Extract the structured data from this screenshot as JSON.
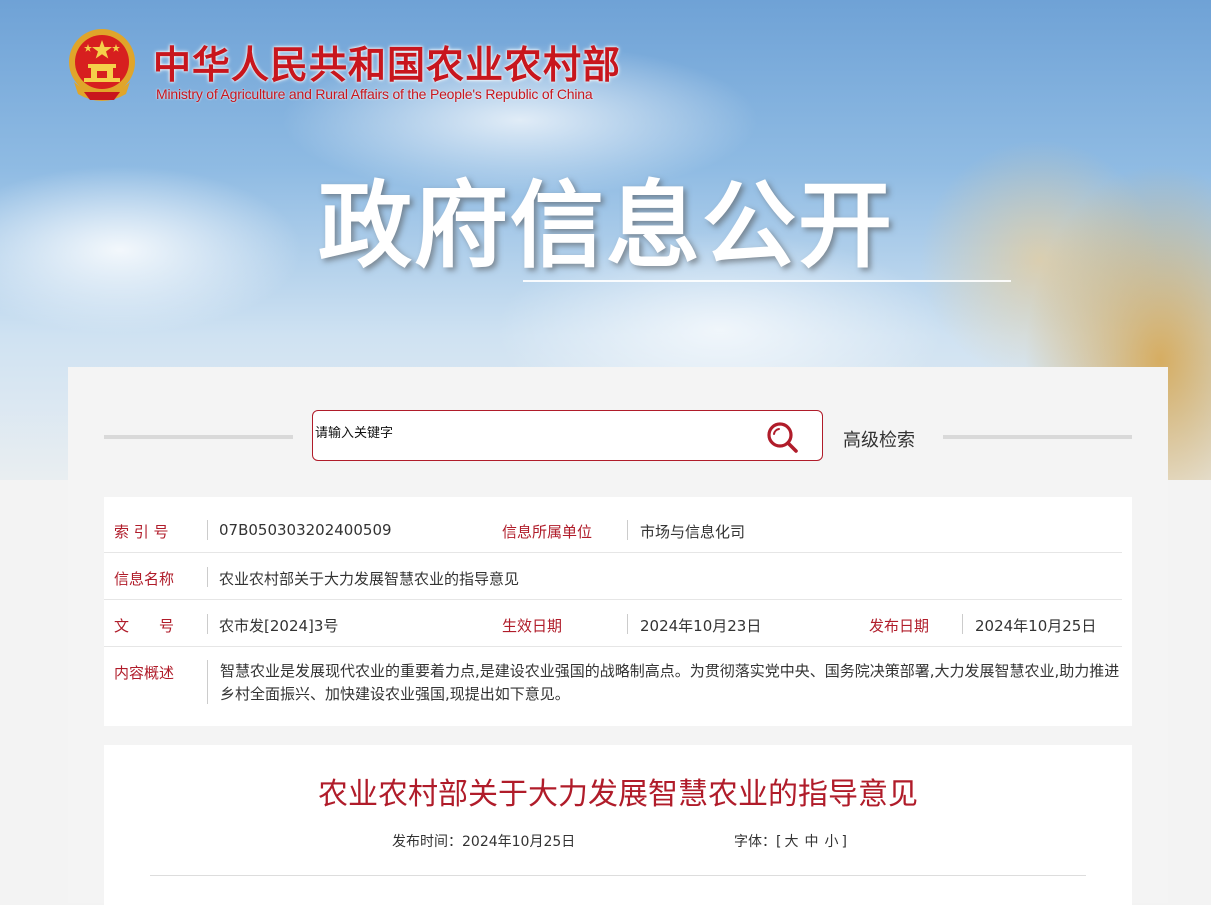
{
  "header": {
    "site_title": "中华人民共和国农业农村部",
    "site_subtitle": "Ministry of Agriculture and Rural Affairs of the People's Republic of China",
    "banner_title": "政府信息公开"
  },
  "search": {
    "placeholder": "请输入关键字",
    "advanced_label": "高级检索",
    "icon": "search-icon"
  },
  "meta": {
    "index_label": "索 引 号",
    "index_value": "07B050303202400509",
    "unit_label": "信息所属单位",
    "unit_value": "市场与信息化司",
    "name_label": "信息名称",
    "name_value": "农业农村部关于大力发展智慧农业的指导意见",
    "doc_no_label": "文　　号",
    "doc_no_value": "农市发[2024]3号",
    "effective_label": "生效日期",
    "effective_value": "2024年10月23日",
    "publish_label": "发布日期",
    "publish_value": "2024年10月25日",
    "summary_label": "内容概述",
    "summary_value": "智慧农业是发展现代农业的重要着力点,是建设农业强国的战略制高点。为贯彻落实党中央、国务院决策部署,大力发展智慧农业,助力推进乡村全面振兴、加快建设农业强国,现提出如下意见。"
  },
  "document": {
    "title": "农业农村部关于大力发展智慧农业的指导意见",
    "publish_time_label": "发布时间：",
    "publish_time_value": "2024年10月25日",
    "font_label": "字体：",
    "font_open": "[",
    "font_large": "大",
    "font_medium": "中",
    "font_small": "小",
    "font_close": "]"
  },
  "colors": {
    "accent_red": "#b01c2a",
    "title_red": "#c8161d"
  }
}
